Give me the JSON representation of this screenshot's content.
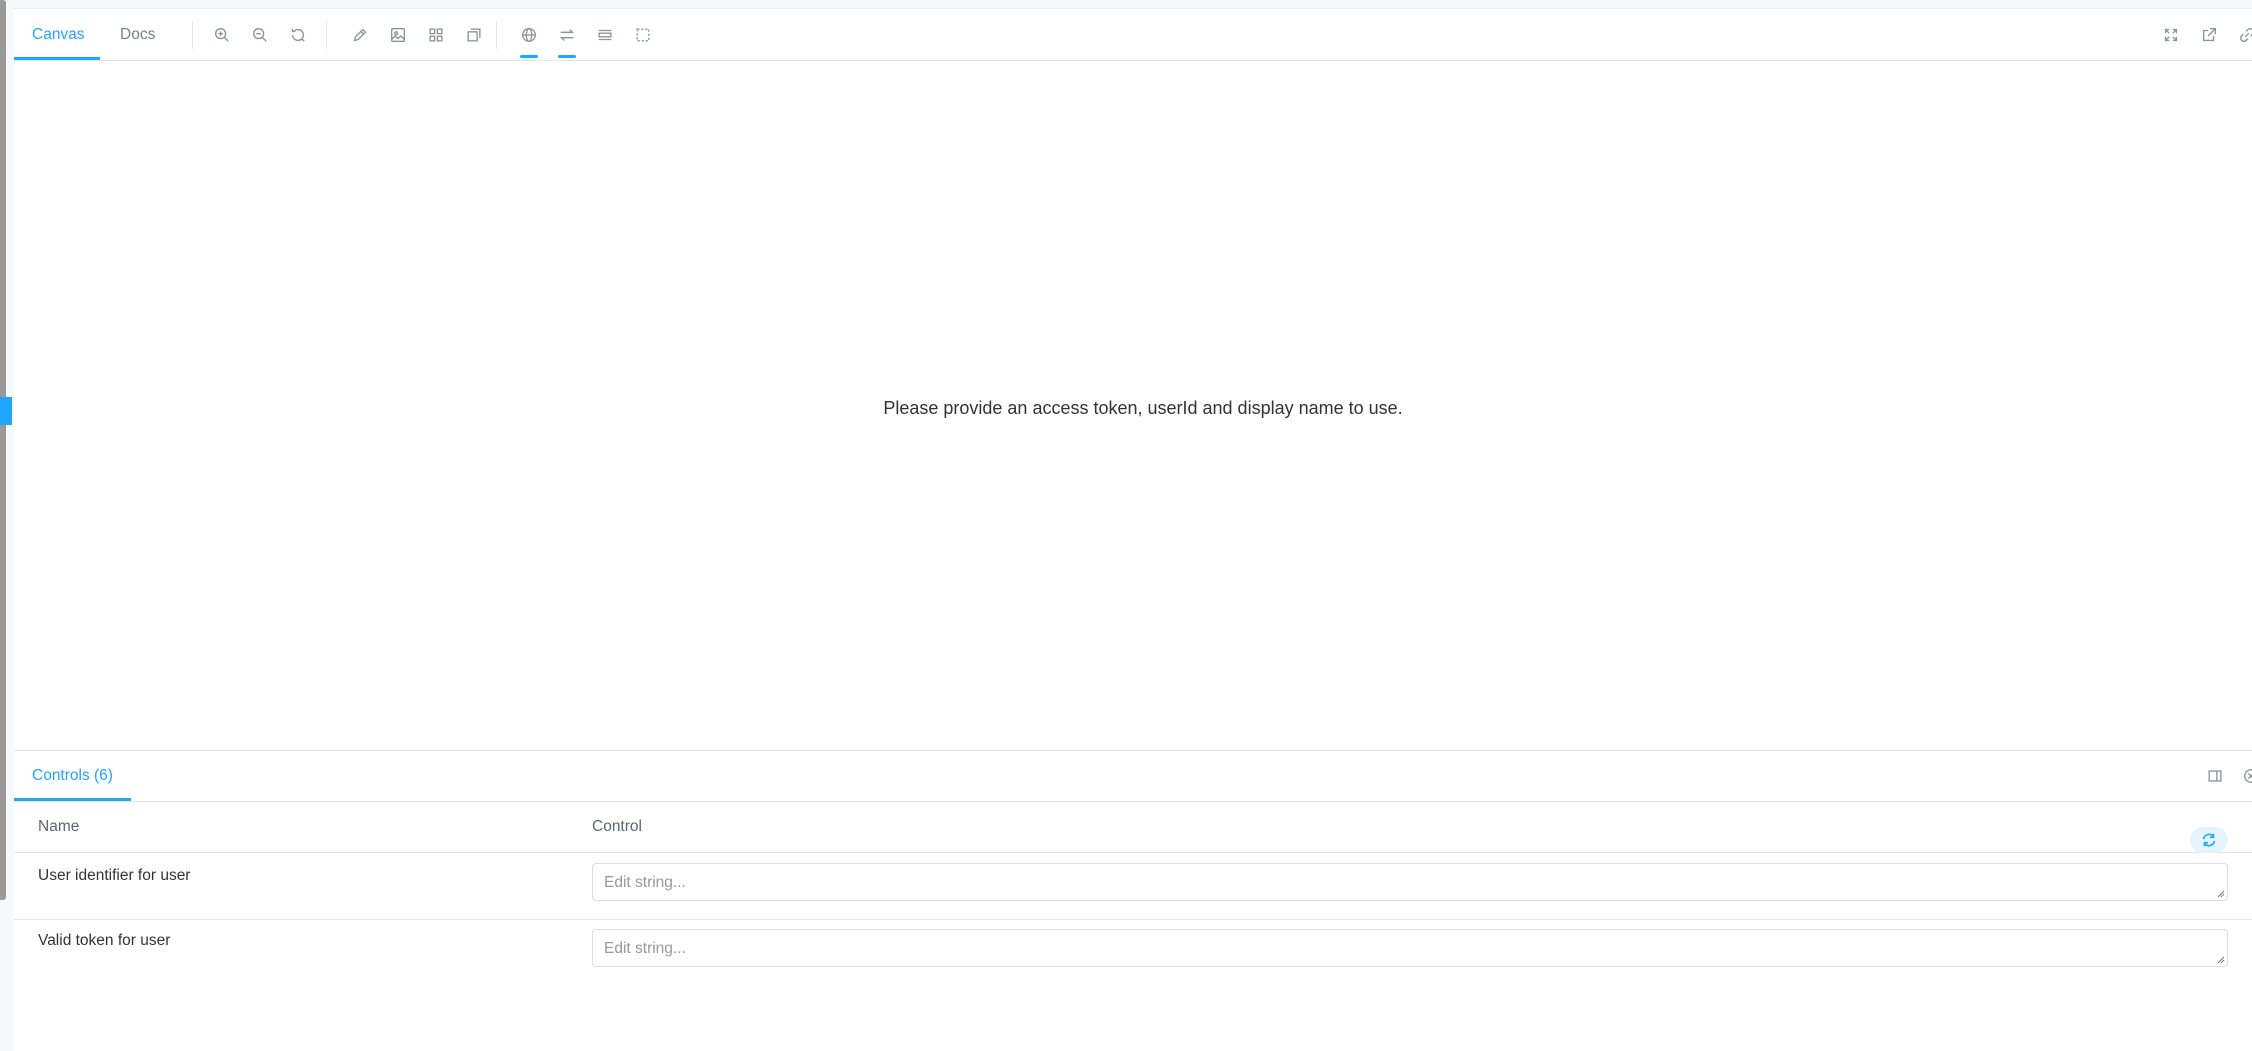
{
  "toolbar": {
    "tabs": [
      {
        "label": "Canvas",
        "active": true
      },
      {
        "label": "Docs",
        "active": false
      }
    ],
    "tools": [
      {
        "name": "zoom-in"
      },
      {
        "name": "zoom-out"
      },
      {
        "name": "reset-zoom"
      },
      {
        "name": "measure-pencil"
      },
      {
        "name": "background-image"
      },
      {
        "name": "grid"
      },
      {
        "name": "outline"
      },
      {
        "name": "locale-globe",
        "active": true
      },
      {
        "name": "text-direction",
        "active": true
      },
      {
        "name": "viewport"
      },
      {
        "name": "select-area"
      }
    ],
    "right_tools": [
      {
        "name": "fullscreen"
      },
      {
        "name": "open-new-tab"
      },
      {
        "name": "copy-link"
      }
    ]
  },
  "canvas": {
    "message": "Please provide an access token, userId and display name to use."
  },
  "addons": {
    "tab_label": "Controls (6)",
    "columns": {
      "name": "Name",
      "control": "Control"
    },
    "rows": [
      {
        "name": "User identifier for user",
        "placeholder": "Edit string..."
      },
      {
        "name": "Valid token for user",
        "placeholder": "Edit string..."
      }
    ]
  },
  "colors": {
    "accent": "#1ea7fd",
    "text": "#333333",
    "muted": "#73808c",
    "border": "#e3e6ea"
  }
}
